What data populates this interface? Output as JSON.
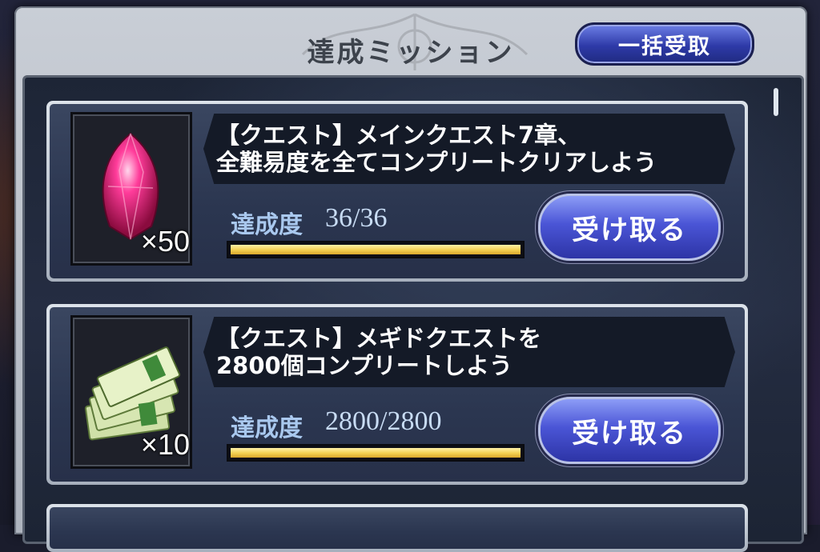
{
  "dialog": {
    "title": "達成ミッション",
    "claim_all_label": "一括受取"
  },
  "missions": [
    {
      "reward_icon": "magenta-crystal-icon",
      "reward_qty": "×50",
      "description": "【クエスト】メインクエスト7章、\n全難易度を全てコンプリートクリアしよう",
      "progress_label": "達成度",
      "progress_text": "36/36",
      "progress_fraction": 1.0,
      "button_label": "受け取る"
    },
    {
      "reward_icon": "ticket-stack-icon",
      "reward_qty": "×10",
      "description": "【クエスト】メギドクエストを\n2800個コンプリートしよう",
      "progress_label": "達成度",
      "progress_text": "2800/2800",
      "progress_fraction": 1.0,
      "button_label": "受け取る"
    }
  ],
  "colors": {
    "progress_bar": "#f2cf50",
    "button": "#4a55d6",
    "panel": "#2b3650"
  }
}
